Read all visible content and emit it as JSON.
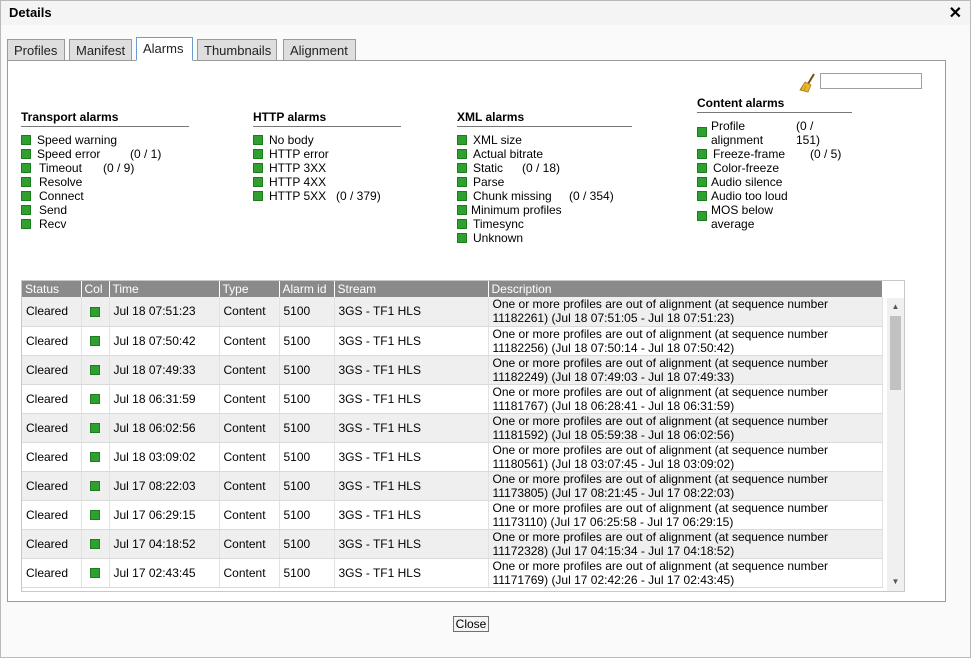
{
  "window": {
    "title": "Details",
    "close_glyph": "✕"
  },
  "tabs": [
    {
      "label": "Profiles"
    },
    {
      "label": "Manifest"
    },
    {
      "label": "Alarms"
    },
    {
      "label": "Thumbnails"
    },
    {
      "label": "Alignment"
    }
  ],
  "active_tab": "Alarms",
  "filter": {
    "value": "",
    "icon": "broom-icon"
  },
  "status_color": "#2fa02f",
  "transport": {
    "title": "Transport alarms",
    "items": [
      {
        "label": "Speed warning",
        "count": ""
      },
      {
        "label": "Speed error",
        "count": "(0 / 1)"
      },
      {
        "label": "Timeout",
        "count": "(0 / 9)"
      },
      {
        "label": "Resolve",
        "count": ""
      },
      {
        "label": "Connect",
        "count": ""
      },
      {
        "label": "Send",
        "count": ""
      },
      {
        "label": "Recv",
        "count": ""
      }
    ]
  },
  "http": {
    "title": "HTTP alarms",
    "items": [
      {
        "label": "No body",
        "count": ""
      },
      {
        "label": "HTTP error",
        "count": ""
      },
      {
        "label": "HTTP 3XX",
        "count": ""
      },
      {
        "label": "HTTP 4XX",
        "count": ""
      },
      {
        "label": "HTTP 5XX",
        "count": "(0 / 379)"
      }
    ]
  },
  "xml": {
    "title": "XML alarms",
    "items": [
      {
        "label": "XML size",
        "count": ""
      },
      {
        "label": "Actual bitrate",
        "count": ""
      },
      {
        "label": "Static",
        "count": "(0 / 18)"
      },
      {
        "label": "Parse",
        "count": ""
      },
      {
        "label": "Chunk missing",
        "count": "(0 / 354)"
      },
      {
        "label": "Minimum profiles",
        "count": ""
      },
      {
        "label": "Timesync",
        "count": ""
      },
      {
        "label": "Unknown",
        "count": ""
      }
    ]
  },
  "content": {
    "title": "Content alarms",
    "items": [
      {
        "label": "Profile alignment",
        "count": "(0 / 151)"
      },
      {
        "label": "Freeze-frame",
        "count": "(0 / 5)"
      },
      {
        "label": "Color-freeze",
        "count": ""
      },
      {
        "label": "Audio silence",
        "count": ""
      },
      {
        "label": "Audio too loud",
        "count": ""
      },
      {
        "label": "MOS below average",
        "count": ""
      }
    ]
  },
  "table": {
    "columns": [
      "Status",
      "Col",
      "Time",
      "Type",
      "Alarm id",
      "Stream",
      "Description"
    ],
    "rows": [
      {
        "status": "Cleared",
        "time": "Jul 18 07:51:23",
        "type": "Content",
        "alarm_id": "5100",
        "stream": "3GS - TF1 HLS",
        "description": "One or more profiles are out of alignment (at sequence number 11182261) (Jul 18 07:51:05 - Jul 18 07:51:23)"
      },
      {
        "status": "Cleared",
        "time": "Jul 18 07:50:42",
        "type": "Content",
        "alarm_id": "5100",
        "stream": "3GS - TF1 HLS",
        "description": "One or more profiles are out of alignment (at sequence number 11182256) (Jul 18 07:50:14 - Jul 18 07:50:42)"
      },
      {
        "status": "Cleared",
        "time": "Jul 18 07:49:33",
        "type": "Content",
        "alarm_id": "5100",
        "stream": "3GS - TF1 HLS",
        "description": "One or more profiles are out of alignment (at sequence number 11182249) (Jul 18 07:49:03 - Jul 18 07:49:33)"
      },
      {
        "status": "Cleared",
        "time": "Jul 18 06:31:59",
        "type": "Content",
        "alarm_id": "5100",
        "stream": "3GS - TF1 HLS",
        "description": "One or more profiles are out of alignment (at sequence number 11181767) (Jul 18 06:28:41 - Jul 18 06:31:59)"
      },
      {
        "status": "Cleared",
        "time": "Jul 18 06:02:56",
        "type": "Content",
        "alarm_id": "5100",
        "stream": "3GS - TF1 HLS",
        "description": "One or more profiles are out of alignment (at sequence number 11181592) (Jul 18 05:59:38 - Jul 18 06:02:56)"
      },
      {
        "status": "Cleared",
        "time": "Jul 18 03:09:02",
        "type": "Content",
        "alarm_id": "5100",
        "stream": "3GS - TF1 HLS",
        "description": "One or more profiles are out of alignment (at sequence number 11180561) (Jul 18 03:07:45 - Jul 18 03:09:02)"
      },
      {
        "status": "Cleared",
        "time": "Jul 17 08:22:03",
        "type": "Content",
        "alarm_id": "5100",
        "stream": "3GS - TF1 HLS",
        "description": "One or more profiles are out of alignment (at sequence number 11173805) (Jul 17 08:21:45 - Jul 17 08:22:03)"
      },
      {
        "status": "Cleared",
        "time": "Jul 17 06:29:15",
        "type": "Content",
        "alarm_id": "5100",
        "stream": "3GS - TF1 HLS",
        "description": "One or more profiles are out of alignment (at sequence number 11173110) (Jul 17 06:25:58 - Jul 17 06:29:15)"
      },
      {
        "status": "Cleared",
        "time": "Jul 17 04:18:52",
        "type": "Content",
        "alarm_id": "5100",
        "stream": "3GS - TF1 HLS",
        "description": "One or more profiles are out of alignment (at sequence number 11172328) (Jul 17 04:15:34 - Jul 17 04:18:52)"
      },
      {
        "status": "Cleared",
        "time": "Jul 17 02:43:45",
        "type": "Content",
        "alarm_id": "5100",
        "stream": "3GS - TF1 HLS",
        "description": "One or more profiles are out of alignment (at sequence number 11171769) (Jul 17 02:42:26 - Jul 17 02:43:45)"
      }
    ]
  },
  "footer": {
    "close_label": "Close"
  }
}
